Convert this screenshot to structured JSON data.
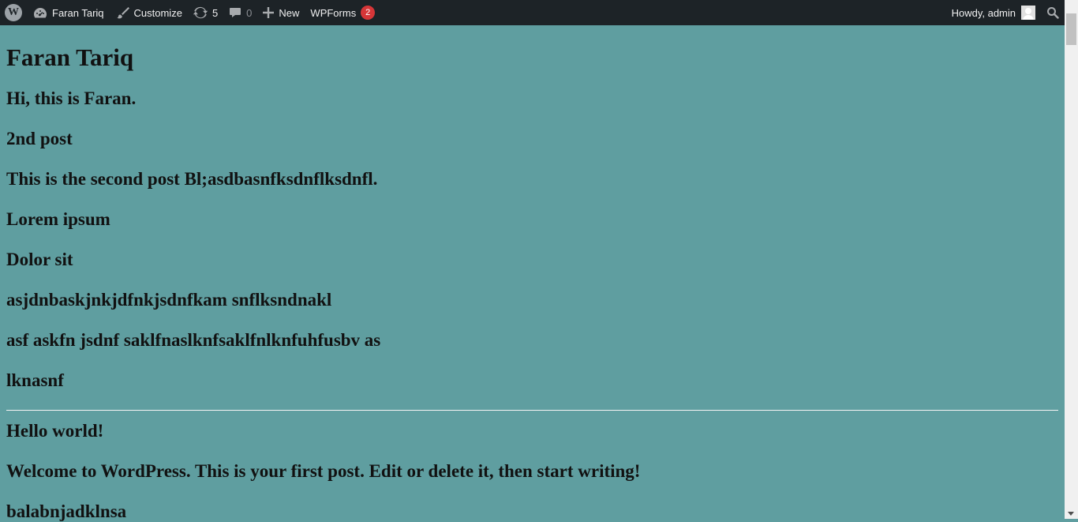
{
  "adminbar": {
    "wp_logo_icon": "wordpress-logo-icon",
    "site_name": "Faran Tariq",
    "customize": "Customize",
    "updates_count": "5",
    "comments_count": "0",
    "new_label": "New",
    "wpforms_label": "WPForms",
    "wpforms_badge": "2",
    "howdy": "Howdy, admin"
  },
  "page": {
    "site_title": "Faran Tariq",
    "post1": {
      "excerpt": "Hi, this is Faran.",
      "title": "2nd post",
      "lines": [
        "This is the second post Bl;asdbasnfksdnflksdnfl.",
        "Lorem ipsum",
        "Dolor sit",
        "asjdnbaskjnkjdfnkjsdnfkam snflksndnakl",
        "asf askfn jsdnf saklfnaslknfsaklfnlknfuhfusbv as",
        "lknasnf"
      ]
    },
    "post2": {
      "title": "Hello world!",
      "lines": [
        "Welcome to WordPress. This is your first post. Edit or delete it, then start writing!",
        "balabnjadklnsa"
      ]
    }
  },
  "colors": {
    "background": "#5f9ea0",
    "adminbar": "#1d2327",
    "badge": "#d63638"
  }
}
